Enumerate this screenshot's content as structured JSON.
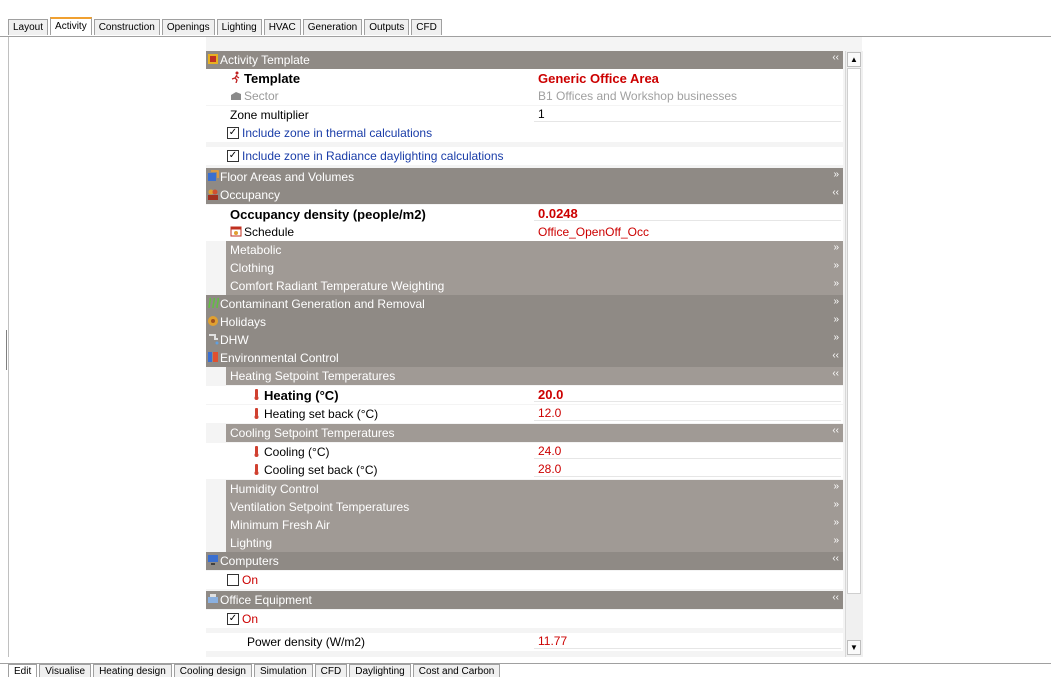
{
  "top_tabs": [
    "Layout",
    "Activity",
    "Construction",
    "Openings",
    "Lighting",
    "HVAC",
    "Generation",
    "Outputs",
    "CFD"
  ],
  "bottom_tabs": [
    "Edit",
    "Visualise",
    "Heating design",
    "Cooling design",
    "Simulation",
    "CFD",
    "Daylighting",
    "Cost and Carbon"
  ],
  "activity_template": {
    "header": "Activity Template",
    "template_label": "Template",
    "template_value": "Generic Office Area",
    "sector_label": "Sector",
    "sector_value": "B1 Offices and Workshop businesses",
    "zone_multiplier_label": "Zone multiplier",
    "zone_multiplier_value": "1",
    "thermal_label": "Include zone in thermal calculations",
    "radiance_label": "Include zone in Radiance daylighting calculations"
  },
  "floor_areas": "Floor Areas and Volumes",
  "occupancy": {
    "header": "Occupancy",
    "density_label": "Occupancy density (people/m2)",
    "density_value": "0.0248",
    "schedule_label": "Schedule",
    "schedule_value": "Office_OpenOff_Occ",
    "metabolic": "Metabolic",
    "clothing": "Clothing",
    "comfort": "Comfort Radiant Temperature Weighting"
  },
  "contaminant": "Contaminant Generation and Removal",
  "holidays": "Holidays",
  "dhw": "DHW",
  "environmental": {
    "header": "Environmental Control",
    "heating_sp": "Heating Setpoint Temperatures",
    "heating_label": "Heating (°C)",
    "heating_value": "20.0",
    "heating_setback_label": "Heating set back (°C)",
    "heating_setback_value": "12.0",
    "cooling_sp": "Cooling Setpoint Temperatures",
    "cooling_label": "Cooling (°C)",
    "cooling_value": "24.0",
    "cooling_setback_label": "Cooling set back (°C)",
    "cooling_setback_value": "28.0",
    "humidity": "Humidity Control",
    "ventilation": "Ventilation Setpoint Temperatures",
    "fresh_air": "Minimum Fresh Air",
    "lighting": "Lighting"
  },
  "computers": {
    "header": "Computers",
    "on_label": "On"
  },
  "office_equipment": {
    "header": "Office Equipment",
    "on_label": "On",
    "power_label": "Power density (W/m2)",
    "power_value": "11.77"
  },
  "colors": {
    "header": "#8f8a85",
    "subheader": "#a09a95",
    "value_red": "#cc0000",
    "link_blue": "#1a3da8",
    "active_tab": "#f0a030"
  }
}
